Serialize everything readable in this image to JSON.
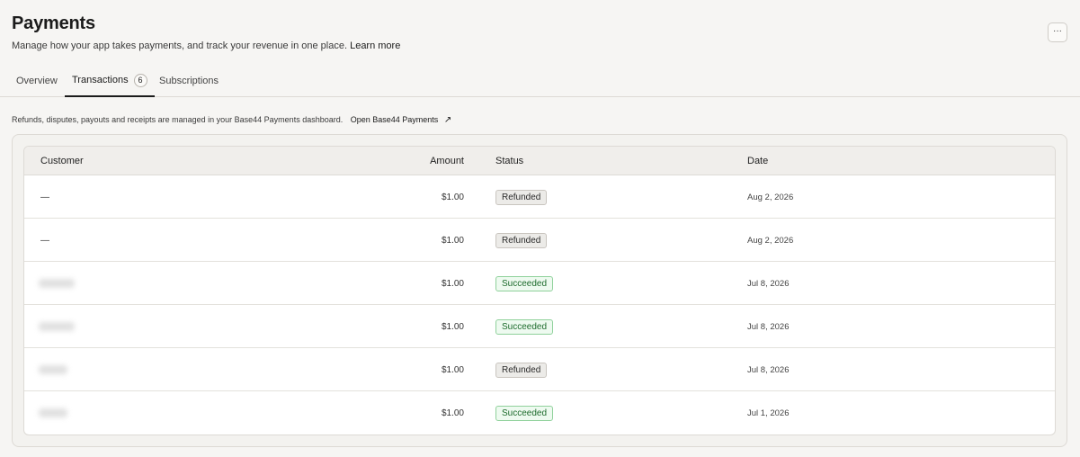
{
  "header": {
    "title": "Payments",
    "subtitle": "Manage how your app takes payments, and track your revenue in one place.",
    "learn_more": "Learn more",
    "more_label": "···"
  },
  "tabs": [
    {
      "label": "Overview",
      "active": false
    },
    {
      "label": "Transactions",
      "active": true,
      "count": "6"
    },
    {
      "label": "Subscriptions",
      "active": false
    }
  ],
  "notice": {
    "text": "Refunds, disputes, payouts and receipts are managed in your Base44 Payments dashboard.",
    "link": "Open Base44 Payments",
    "arrow": "↗"
  },
  "table": {
    "columns": [
      "Customer",
      "Amount",
      "Status",
      "Date"
    ],
    "rows": [
      {
        "customer": "—",
        "amount": "$1.00",
        "status": "Refunded",
        "date": "Aug 2, 2026"
      },
      {
        "customer": "—",
        "amount": "$1.00",
        "status": "Refunded",
        "date": "Aug 2, 2026"
      },
      {
        "customer": "",
        "amount": "$1.00",
        "status": "Succeeded",
        "date": "Jul 8, 2026"
      },
      {
        "customer": "",
        "amount": "$1.00",
        "status": "Succeeded",
        "date": "Jul 8, 2026"
      },
      {
        "customer": "",
        "amount": "$1.00",
        "status": "Refunded",
        "date": "Jul 8, 2026"
      },
      {
        "customer": "",
        "amount": "$1.00",
        "status": "Succeeded",
        "date": "Jul 1, 2026"
      }
    ]
  },
  "colors": {
    "background": "#f6f5f3",
    "succeeded_bg": "#eefaf0",
    "succeeded_border": "#8fd19b",
    "refunded_bg": "#ecebe8"
  }
}
